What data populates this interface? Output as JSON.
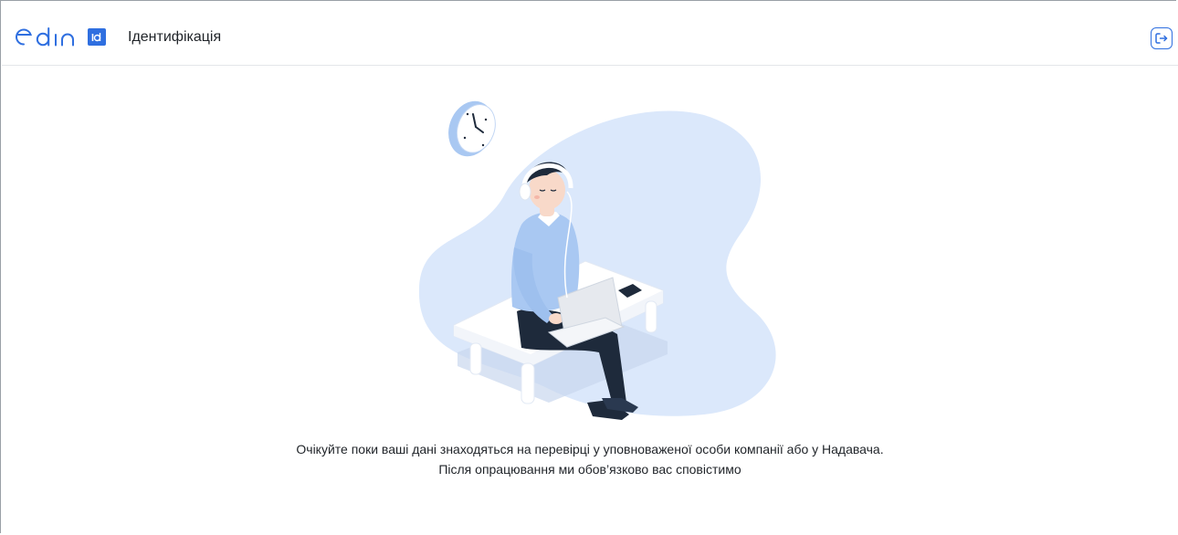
{
  "header": {
    "logo_text": "edin",
    "logo_badge": "id",
    "title": "Ідентифікація",
    "logout_icon": "logout-icon",
    "accent_color": "#2f6fe0"
  },
  "main": {
    "illustration": "person-with-laptop-waiting-illustration",
    "message_line_1": "Очікуйте поки ваші дані знаходяться на перевірці у уповноваженої особи компанії або у Надавача.",
    "message_line_2": "Після опрацювання ми обов’язково вас сповістимо"
  }
}
